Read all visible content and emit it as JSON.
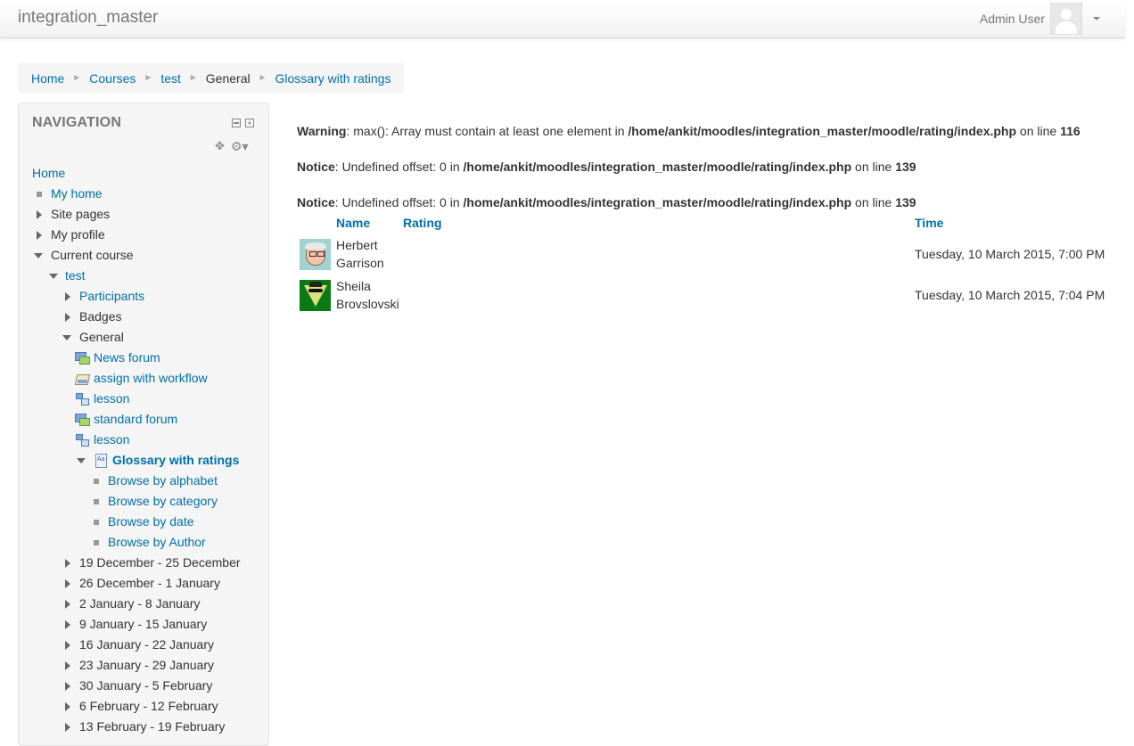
{
  "navbar": {
    "brand": "integration_master",
    "user_name": "Admin User"
  },
  "breadcrumb": [
    "Home",
    "Courses",
    "test",
    "General",
    "Glossary with ratings"
  ],
  "navigation": {
    "title": "NAVIGATION",
    "items": [
      {
        "label": "Home"
      },
      {
        "label": "My home"
      },
      {
        "label": "Site pages"
      },
      {
        "label": "My profile"
      },
      {
        "label": "Current course"
      },
      {
        "label": "test"
      },
      {
        "label": "Participants"
      },
      {
        "label": "Badges"
      },
      {
        "label": "General"
      },
      {
        "label": "News forum"
      },
      {
        "label": "assign with workflow"
      },
      {
        "label": "lesson"
      },
      {
        "label": "standard forum"
      },
      {
        "label": "lesson"
      },
      {
        "label": "Glossary with ratings"
      },
      {
        "label": "Browse by alphabet"
      },
      {
        "label": "Browse by category"
      },
      {
        "label": "Browse by date"
      },
      {
        "label": "Browse by Author"
      },
      {
        "label": "19 December - 25 December"
      },
      {
        "label": "26 December - 1 January"
      },
      {
        "label": "2 January - 8 January"
      },
      {
        "label": "9 January - 15 January"
      },
      {
        "label": "16 January - 22 January"
      },
      {
        "label": "23 January - 29 January"
      },
      {
        "label": "30 January - 5 February"
      },
      {
        "label": "6 February - 12 February"
      },
      {
        "label": "13 February - 19 February"
      }
    ]
  },
  "messages": [
    {
      "type": "Warning",
      "text1": ": max(): Array must contain at least one element in ",
      "path": "/home/ankit/moodles/integration_master/moodle/rating/index.php",
      "text2": " on line ",
      "line": "116"
    },
    {
      "type": "Notice",
      "text1": ": Undefined offset: 0 in ",
      "path": "/home/ankit/moodles/integration_master/moodle/rating/index.php",
      "text2": " on line ",
      "line": "139"
    },
    {
      "type": "Notice",
      "text1": ": Undefined offset: 0 in ",
      "path": "/home/ankit/moodles/integration_master/moodle/rating/index.php",
      "text2": " on line ",
      "line": "139"
    }
  ],
  "table": {
    "headers": {
      "name": "Name",
      "rating": "Rating",
      "time": "Time"
    },
    "rows": [
      {
        "first": "Herbert",
        "last": "Garrison",
        "time": "Tuesday, 10 March 2015, 7:00 PM"
      },
      {
        "first": "Sheila",
        "last": "Brovslovski",
        "time": "Tuesday, 10 March 2015, 7:04 PM"
      }
    ]
  },
  "icons": {
    "move": "move-icon",
    "settings": "gear-icon"
  }
}
